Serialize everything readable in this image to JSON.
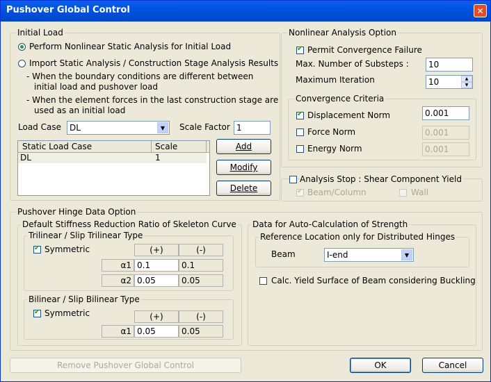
{
  "window": {
    "title": "Pushover Global Control",
    "close_glyph": "✕"
  },
  "initial_load": {
    "legend": "Initial Load",
    "radio_perform": "Perform Nonlinear Static Analysis for Initial Load",
    "radio_import": "Import Static Analysis / Construction Stage Analysis Results",
    "note1_line1": "- When the boundary conditions are different between",
    "note1_line2": "initial load and pushover load",
    "note2_line1": "- When the element forces in the last construction stage are",
    "note2_line2": "used as an initial load",
    "load_case_label": "Load Case",
    "load_case_value": "DL",
    "scale_factor_label": "Scale Factor",
    "scale_factor_value": "1",
    "table_headers": [
      "Static Load Case",
      "Scale"
    ],
    "table_rows": [
      {
        "case": "DL",
        "scale": "1"
      }
    ],
    "add_button": "Add",
    "modify_button": "Modify",
    "delete_button": "Delete"
  },
  "nonlinear": {
    "legend": "Nonlinear Analysis Option",
    "permit_label": "Permit Convergence Failure",
    "max_substeps_label": "Max. Number of Substeps :",
    "max_substeps_value": "10",
    "max_iteration_label": "Maximum Iteration",
    "max_iteration_value": "10",
    "criteria_legend": "Convergence Criteria",
    "displacement_label": "Displacement Norm",
    "displacement_value": "0.001",
    "force_label": "Force Norm",
    "force_value": "0.001",
    "energy_label": "Energy Norm",
    "energy_value": "0.001"
  },
  "analysis_stop": {
    "label": "Analysis Stop : Shear Component Yield",
    "beam_column": "Beam/Column",
    "wall": "Wall"
  },
  "hinge": {
    "legend": "Pushover Hinge Data Option",
    "stiffness_legend": "Default Stiffness Reduction Ratio of Skeleton Curve",
    "trilinear_legend": "Trilinear / Slip Trilinear Type",
    "symmetric": "Symmetric",
    "plus": "(+)",
    "minus": "(-)",
    "alpha1": "α1",
    "alpha2": "α2",
    "tri_a1_plus": "0.1",
    "tri_a1_minus": "0.1",
    "tri_a2_plus": "0.05",
    "tri_a2_minus": "0.05",
    "bilinear_legend": "Bilinear / Slip Bilinear Type",
    "bi_a1_plus": "0.05",
    "bi_a1_minus": "0.05",
    "auto_legend": "Data for Auto-Calculation of Strength",
    "ref_legend": "Reference Location only for Distributed Hinges",
    "beam_label": "Beam",
    "beam_value": "I-end",
    "buckling_label": "Calc. Yield Surface of Beam considering Buckling"
  },
  "footer": {
    "remove_button": "Remove Pushover Global Control",
    "ok_button": "OK",
    "cancel_button": "Cancel"
  }
}
